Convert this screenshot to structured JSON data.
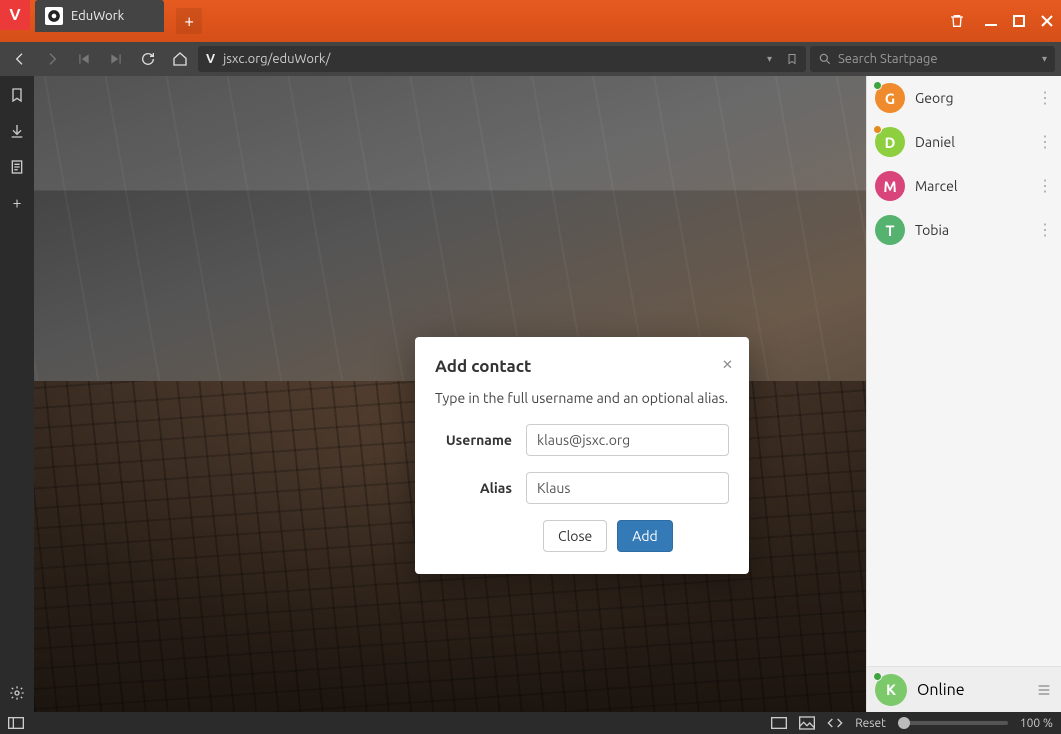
{
  "window": {
    "tab_title": "EduWork",
    "url": "jsxc.org/eduWork/",
    "search_placeholder": "Search Startpage"
  },
  "modal": {
    "title": "Add contact",
    "desc": "Type in the full username and an optional alias.",
    "username_label": "Username",
    "username_value": "klaus@jsxc.org",
    "alias_label": "Alias",
    "alias_value": "Klaus",
    "close_label": "Close",
    "add_label": "Add"
  },
  "roster": {
    "contacts": [
      {
        "name": "Georg",
        "initial": "G",
        "avatar_color": "#ef8b2c",
        "presence": "#3fa33f"
      },
      {
        "name": "Daniel",
        "initial": "D",
        "avatar_color": "#8dcf3f",
        "presence": "#e58a1f"
      },
      {
        "name": "Marcel",
        "initial": "M",
        "avatar_color": "#d9447a",
        "presence": ""
      },
      {
        "name": "Tobia",
        "initial": "T",
        "avatar_color": "#56b26f",
        "presence": ""
      }
    ],
    "self": {
      "name": "Online",
      "initial": "K",
      "avatar_color": "#7cc96b",
      "presence": "#3fa33f"
    }
  },
  "statusbar": {
    "reset_label": "Reset",
    "zoom_label": "100 %"
  }
}
